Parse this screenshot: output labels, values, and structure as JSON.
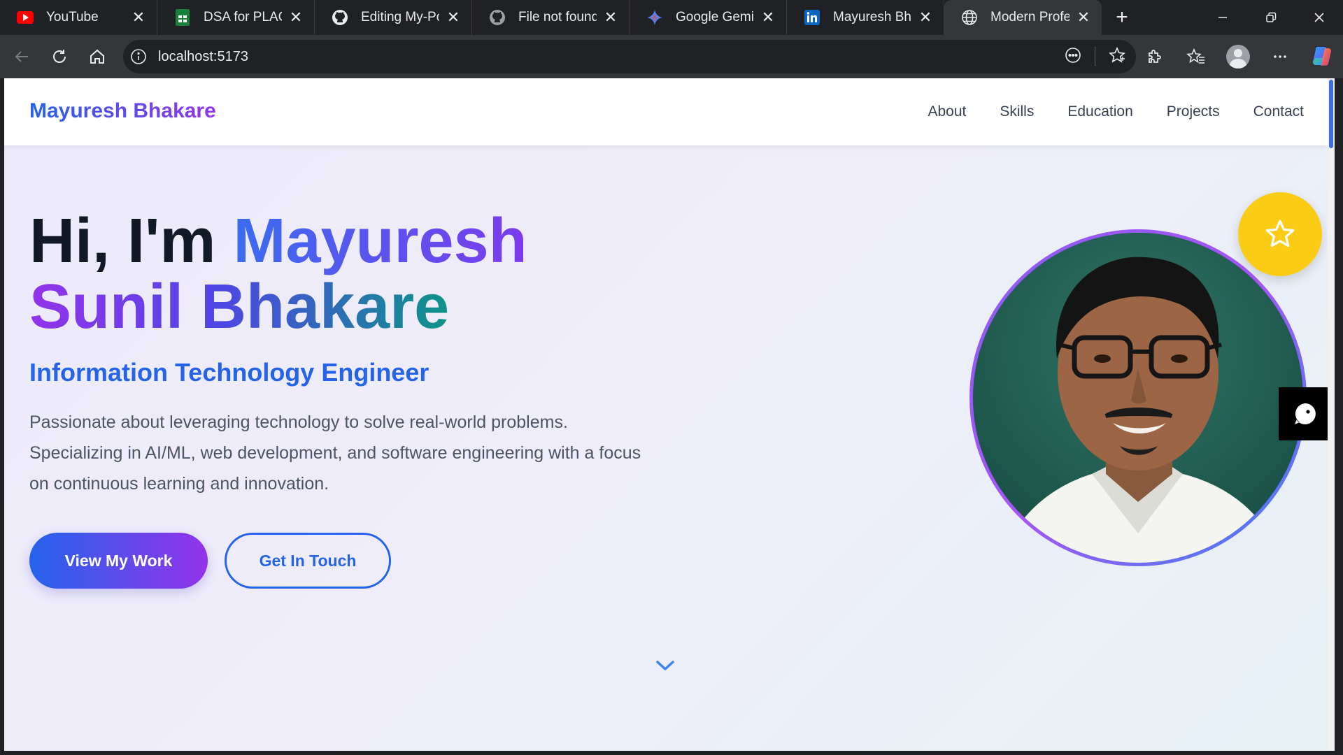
{
  "browser": {
    "tabs": [
      {
        "title": "YouTube",
        "icon": "youtube-icon"
      },
      {
        "title": "DSA for PLACEMENT",
        "icon": "sheets-icon"
      },
      {
        "title": "Editing My-Portfolio",
        "icon": "github-icon"
      },
      {
        "title": "File not found",
        "icon": "github-icon"
      },
      {
        "title": "Google Gemini",
        "icon": "gemini-icon"
      },
      {
        "title": "Mayuresh Bhakare",
        "icon": "linkedin-icon"
      },
      {
        "title": "Modern Professional",
        "icon": "globe-icon",
        "active": true
      }
    ],
    "url": "localhost:5173"
  },
  "site": {
    "logo": "Mayuresh Bhakare",
    "nav": [
      "About",
      "Skills",
      "Education",
      "Projects",
      "Contact"
    ],
    "hero": {
      "greeting": "Hi, I'm",
      "name_line1": "Mayuresh",
      "name_line2": "Sunil Bhakare",
      "subtitle": "Information Technology Engineer",
      "description": "Passionate about leveraging technology to solve real-world problems. Specializing in AI/ML, web development, and software engineering with a focus on continuous learning and innovation.",
      "primary_button": "View My Work",
      "secondary_button": "Get In Touch"
    }
  },
  "colors": {
    "brand_blue": "#2563eb",
    "brand_purple": "#9333ea",
    "badge_yellow": "#facc15"
  }
}
